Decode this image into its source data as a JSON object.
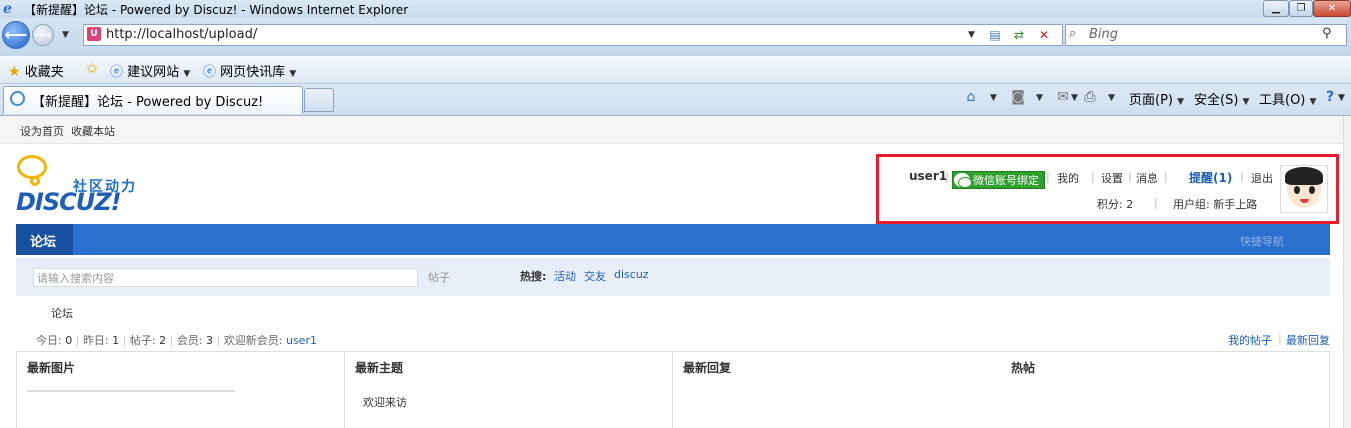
{
  "browser": {
    "window_title": "【新提醒】论坛 - Powered by Discuz! - Windows Internet Explorer",
    "url": "http://localhost/upload/",
    "search_placeholder": "Bing",
    "favorites": {
      "label": "收藏夹",
      "items": [
        "建议网站",
        "网页快讯库"
      ]
    },
    "tab_title": "【新提醒】论坛 - Powered by Discuz!",
    "commands": {
      "page": "页面(P)",
      "safety": "安全(S)",
      "tools": "工具(O)"
    }
  },
  "site": {
    "top_links": [
      "设为首页",
      "收藏本站"
    ],
    "logo": {
      "cn": "社区动力",
      "en": "DISCUZ!"
    }
  },
  "user": {
    "name": "user1",
    "wechat_bind": "微信账号绑定",
    "links": {
      "mine": "我的",
      "settings": "设置",
      "messages": "消息",
      "remind": "提醒(1)",
      "logout": "退出"
    },
    "points": "积分: 2",
    "group": "用户组: 新手上路"
  },
  "nav": {
    "active": "论坛",
    "quick": "快捷导航"
  },
  "search": {
    "placeholder": "请输入搜索内容",
    "type": "帖子",
    "hot_label": "热搜:",
    "hot": [
      "活动",
      "交友",
      "discuz"
    ]
  },
  "breadcrumb": "论坛",
  "stats": {
    "today_label": "今日:",
    "today": "0",
    "yesterday_label": "昨日:",
    "yesterday": "1",
    "posts_label": "帖子:",
    "posts": "2",
    "members_label": "会员:",
    "members": "3",
    "welcome_label": "欢迎新会员:",
    "newest_member": "user1"
  },
  "right_links": [
    "我的帖子",
    "最新回复"
  ],
  "grid": {
    "headers": [
      "最新图片",
      "最新主题",
      "最新回复",
      "热帖"
    ],
    "latest_topics": [
      "欢迎来访"
    ]
  },
  "colors": {
    "nav_blue": "#2b6fcf",
    "highlight_red": "#ea1b2c",
    "wechat_green": "#2ea12e",
    "link_blue": "#1e5fb5"
  }
}
